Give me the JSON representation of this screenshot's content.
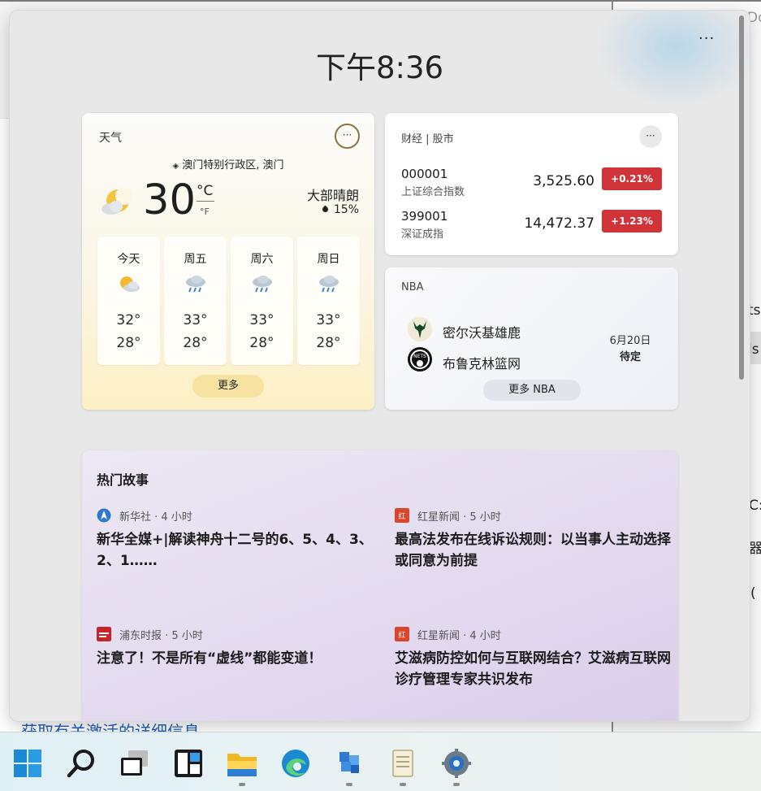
{
  "background": {
    "fragments": [
      "Do",
      "ts",
      "ls",
      "C:",
      "器",
      "("
    ],
    "link_text": "获取有关激活的详细信息"
  },
  "panel": {
    "more_label": "···",
    "clock": "下午8:36"
  },
  "weather": {
    "title": "天气",
    "menu_label": "···",
    "location": "澳门特别行政区, 澳门",
    "temperature": "30",
    "unit_c": "°C",
    "unit_f": "°F",
    "condition": "大部晴朗",
    "precipitation": "15%",
    "forecast": [
      {
        "day": "今天",
        "icon": "partly-sunny-icon",
        "high": "32°",
        "low": "28°"
      },
      {
        "day": "周五",
        "icon": "rain-icon",
        "high": "33°",
        "low": "28°"
      },
      {
        "day": "周六",
        "icon": "rain-icon",
        "high": "33°",
        "low": "28°"
      },
      {
        "day": "周日",
        "icon": "rain-icon",
        "high": "33°",
        "low": "28°"
      }
    ],
    "more_button": "更多"
  },
  "finance": {
    "title": "财经 | 股市",
    "menu_label": "···",
    "rows": [
      {
        "code": "000001",
        "name": "上证综合指数",
        "value": "3,525.60",
        "change": "+0.21%"
      },
      {
        "code": "399001",
        "name": "深证成指",
        "value": "14,472.37",
        "change": "+1.23%"
      }
    ],
    "change_color": "#d13438"
  },
  "nba": {
    "title": "NBA",
    "teams": [
      {
        "name": "密尔沃基雄鹿",
        "logo": "bucks-logo-icon"
      },
      {
        "name": "布鲁克林篮网",
        "logo": "nets-logo-icon"
      }
    ],
    "date": "6月20日",
    "status": "待定",
    "more_button": "更多 NBA"
  },
  "stories": {
    "title": "热门故事",
    "items": [
      {
        "source": "新华社",
        "age": "4 小时",
        "meta": "新华社 · 4 小时",
        "headline": "新华全媒+|解读神舟十二号的6、5、4、3、2、1……"
      },
      {
        "source": "红星新闻",
        "age": "5 小时",
        "meta": "红星新闻 · 5 小时",
        "headline": "最高法发布在线诉讼规则：以当事人主动选择或同意为前提"
      },
      {
        "source": "浦东时报",
        "age": "5 小时",
        "meta": "浦东时报 · 5 小时",
        "headline": "注意了！不是所有“虚线”都能变道！"
      },
      {
        "source": "红星新闻",
        "age": "4 小时",
        "meta": "红星新闻 · 4 小时",
        "headline": "艾滋病防控如何与互联网结合？艾滋病互联网诊疗管理专家共识发布"
      }
    ]
  },
  "taskbar": {
    "icons": [
      "start-icon",
      "search-icon",
      "task-view-icon",
      "widgets-icon",
      "file-explorer-icon",
      "edge-icon",
      "app-icon",
      "notepad-icon",
      "settings-icon"
    ],
    "accent": "#0078d4"
  }
}
